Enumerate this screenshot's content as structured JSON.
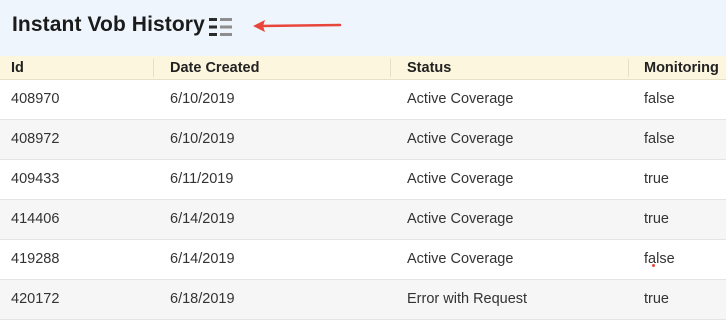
{
  "page": {
    "title": "Instant Vob History"
  },
  "icons": {
    "view_toggle": "list-icon",
    "annotation": "arrow-left-icon"
  },
  "colors": {
    "header_bg": "#eef5fc",
    "table_header_bg": "#fbf6dd",
    "arrow": "#e8463c"
  },
  "table": {
    "columns": [
      "Id",
      "Date Created",
      "Status",
      "Monitoring"
    ],
    "rows": [
      [
        "408970",
        "6/10/2019",
        "Active Coverage",
        "false"
      ],
      [
        "408972",
        "6/10/2019",
        "Active Coverage",
        "false"
      ],
      [
        "409433",
        "6/11/2019",
        "Active Coverage",
        "true"
      ],
      [
        "414406",
        "6/14/2019",
        "Active Coverage",
        "true"
      ],
      [
        "419288",
        "6/14/2019",
        "Active Coverage",
        "false"
      ],
      [
        "420172",
        "6/18/2019",
        "Error with Request",
        "true"
      ]
    ]
  }
}
